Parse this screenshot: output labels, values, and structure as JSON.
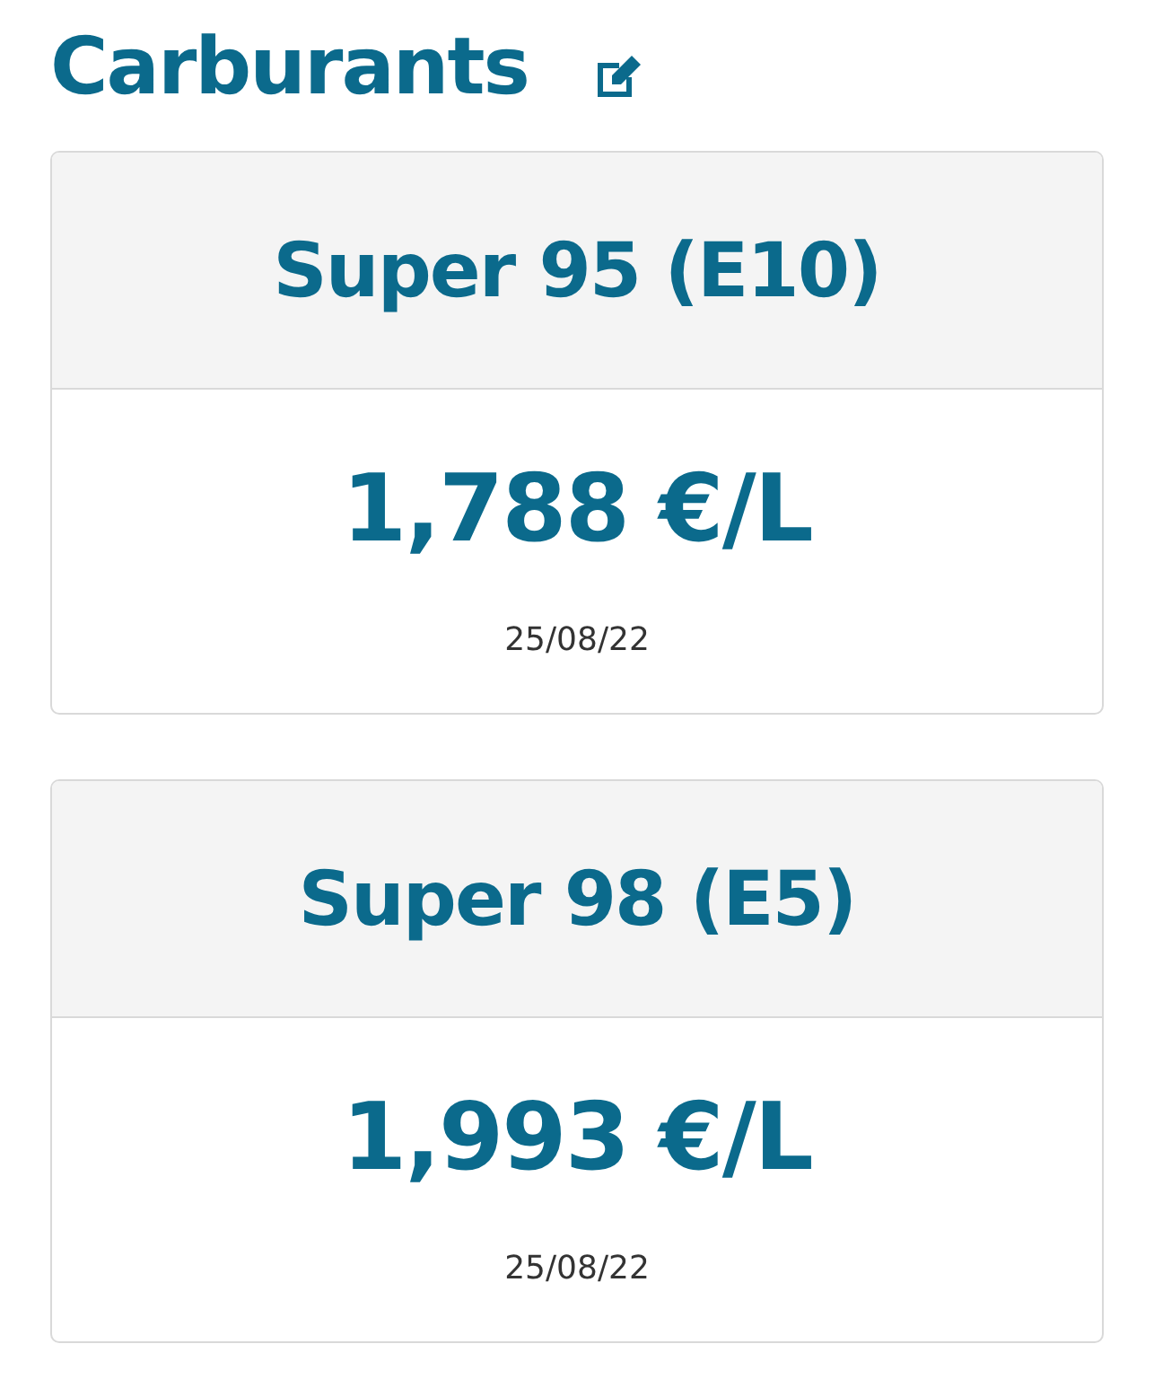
{
  "title": "Carburants",
  "fuels": [
    {
      "name": "Super 95 (E10)",
      "price": "1,788 €/L",
      "date": "25/08/22"
    },
    {
      "name": "Super 98 (E5)",
      "price": "1,993 €/L",
      "date": "25/08/22"
    }
  ]
}
